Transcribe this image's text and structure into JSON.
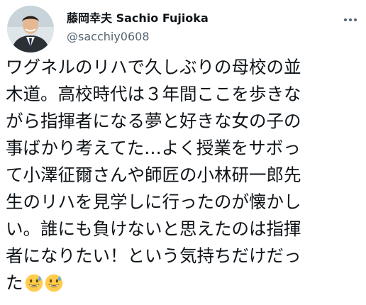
{
  "tweet": {
    "display_name": "藤岡幸夫 Sachio Fujioka",
    "handle": "@sacchiy0608",
    "lines": [
      "ワグネルのリハで久しぶりの母校の並",
      "木道。高校時代は３年間ここを歩きな",
      "がら指揮者になる夢と好きな女の子の",
      "事ばかり考えてた…よく授業をサボっ",
      "て小澤征爾さんや師匠の小林研一郎先",
      "生のリハを見学しに行ったのが懐かし",
      "い。誰にも負けないと思えたのは指揮",
      "者になりたい！という気持ちだけだっ",
      "た"
    ],
    "emojis": [
      "grinning-sweat-emoji",
      "grinning-sweat-emoji"
    ]
  },
  "colors": {
    "text": "#0f1419",
    "secondary": "#536471",
    "background": "#ffffff"
  },
  "icons": {
    "more": "more-horizontal-icon"
  }
}
